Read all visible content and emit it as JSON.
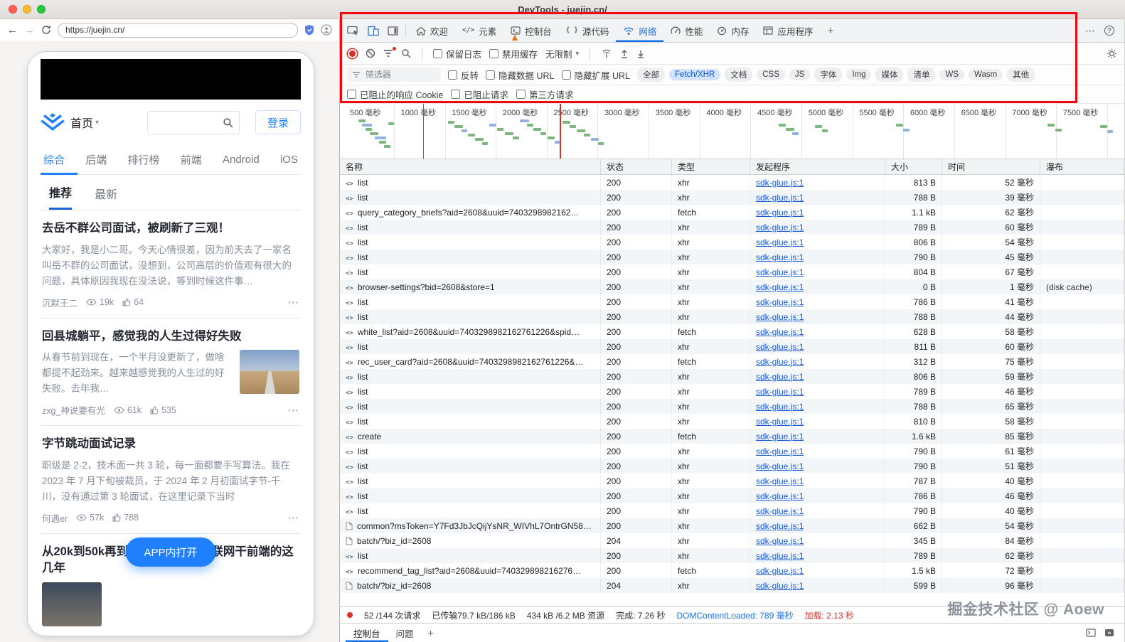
{
  "window": {
    "title": "DevTools - juejin.cn/"
  },
  "browser": {
    "url": "https://juejin.cn/",
    "site": {
      "home_label": "首页",
      "login_label": "登录",
      "nav_tabs": [
        {
          "label": "综合",
          "active": true
        },
        {
          "label": "后端",
          "active": false
        },
        {
          "label": "排行榜",
          "active": false
        },
        {
          "label": "前端",
          "active": false
        },
        {
          "label": "Android",
          "active": false
        },
        {
          "label": "iOS",
          "active": false
        }
      ],
      "sub_tabs": [
        {
          "label": "推荐",
          "active": true
        },
        {
          "label": "最新",
          "active": false
        }
      ],
      "articles": [
        {
          "title": "去岳不群公司面试，被刷新了三观！",
          "excerpt": "大家好，我是小二哥。今天心情很差，因为前天去了一家名叫岳不群的公司面试，没想到，公司高层的价值观有很大的问题，具体原因我现在没法说，等到时候这件事…",
          "author": "沉默王二",
          "views": "19k",
          "likes": "64",
          "has_image": false
        },
        {
          "title": "回县城躺平，感觉我的人生过得好失败",
          "excerpt": "从春节前到现在，一个半月没更新了，做啥都提不起劲来。越来越感觉我的人生过的好失败。去年我…",
          "author": "zxg_神说要有光",
          "views": "61k",
          "likes": "535",
          "has_image": true
        },
        {
          "title": "字节跳动面试记录",
          "excerpt": "职级是 2-2，技术面一共 3 轮，每一面都要手写算法。我在 2023 年 7 月下旬被裁员，于 2024 年 2 月初面试字节-千川，没有通过第 3 轮面试，在这里记录下当时",
          "author": "何遇er",
          "views": "57k",
          "likes": "788",
          "has_image": false
        },
        {
          "title": "从20k到50k再到2k，聊聊我在互联网干前端的这几年",
          "excerpt": "",
          "author": "",
          "views": "",
          "likes": "",
          "has_image": true
        }
      ],
      "open_in_app": "APP内打开"
    }
  },
  "devtools": {
    "main_tabs": [
      {
        "icon": "home-icon",
        "label": "欢迎",
        "active": false
      },
      {
        "icon": "elements-icon",
        "label": "元素",
        "active": false
      },
      {
        "icon": "console-icon",
        "label": "控制台",
        "active": false,
        "badge": true
      },
      {
        "icon": "sources-icon",
        "label": "源代码",
        "active": false
      },
      {
        "icon": "network-icon",
        "label": "网络",
        "active": true
      },
      {
        "icon": "performance-icon",
        "label": "性能",
        "active": false
      },
      {
        "icon": "memory-icon",
        "label": "内存",
        "active": false
      },
      {
        "icon": "application-icon",
        "label": "应用程序",
        "active": false
      }
    ],
    "more_tabs_label": "+",
    "network_toolbar": {
      "preserve_log": "保留日志",
      "disable_cache": "禁用缓存",
      "throttling": "无限制"
    },
    "filter_bar": {
      "placeholder": "筛选器",
      "invert": "反转",
      "hide_data_urls": "隐藏数据 URL",
      "hide_extension_urls": "隐藏扩展 URL",
      "pills": [
        {
          "label": "全部",
          "active": false
        },
        {
          "label": "Fetch/XHR",
          "active": true
        },
        {
          "label": "文档",
          "active": false
        },
        {
          "label": "CSS",
          "active": false
        },
        {
          "label": "JS",
          "active": false
        },
        {
          "label": "字体",
          "active": false
        },
        {
          "label": "Img",
          "active": false
        },
        {
          "label": "媒体",
          "active": false
        },
        {
          "label": "清单",
          "active": false
        },
        {
          "label": "WS",
          "active": false
        },
        {
          "label": "Wasm",
          "active": false
        },
        {
          "label": "其他",
          "active": false
        }
      ]
    },
    "block_bar": {
      "blocked_cookies": "已阻止的响应 Cookie",
      "blocked_requests": "已阻止请求",
      "third_party": "第三方请求"
    },
    "overview": {
      "tick_labels": [
        "500 毫秒",
        "1000 毫秒",
        "1500 毫秒",
        "2000 毫秒",
        "2500 毫秒",
        "3000 毫秒",
        "3500 毫秒",
        "4000 毫秒",
        "4500 毫秒",
        "5000 毫秒",
        "5500 毫秒",
        "6000 毫秒",
        "6500 毫秒",
        "7000 毫秒",
        "7500 毫秒"
      ],
      "dcl_line_pct": 10.6,
      "load_line_pct": 28.05,
      "bars": [
        {
          "p": 2.4,
          "t": 22,
          "w": 10,
          "c": "g"
        },
        {
          "p": 2.8,
          "t": 28,
          "w": 14,
          "c": "b"
        },
        {
          "p": 3.3,
          "t": 34,
          "w": 9,
          "c": "g"
        },
        {
          "p": 3.8,
          "t": 40,
          "w": 12,
          "c": "g"
        },
        {
          "p": 4.4,
          "t": 46,
          "w": 16,
          "c": "b"
        },
        {
          "p": 5.0,
          "t": 52,
          "w": 10,
          "c": "g"
        },
        {
          "p": 5.6,
          "t": 58,
          "w": 9,
          "c": "g"
        },
        {
          "p": 6.2,
          "t": 26,
          "w": 8,
          "c": "g"
        },
        {
          "p": 13.8,
          "t": 24,
          "w": 9,
          "c": "g"
        },
        {
          "p": 14.6,
          "t": 30,
          "w": 12,
          "c": "g"
        },
        {
          "p": 15.5,
          "t": 36,
          "w": 8,
          "c": "b"
        },
        {
          "p": 16.3,
          "t": 42,
          "w": 10,
          "c": "g"
        },
        {
          "p": 17.2,
          "t": 48,
          "w": 12,
          "c": "g"
        },
        {
          "p": 18.1,
          "t": 54,
          "w": 8,
          "c": "g"
        },
        {
          "p": 19.0,
          "t": 28,
          "w": 10,
          "c": "b"
        },
        {
          "p": 20.0,
          "t": 34,
          "w": 9,
          "c": "g"
        },
        {
          "p": 21.0,
          "t": 40,
          "w": 12,
          "c": "g"
        },
        {
          "p": 22.0,
          "t": 46,
          "w": 9,
          "c": "g"
        },
        {
          "p": 22.9,
          "t": 22,
          "w": 13,
          "c": "b"
        },
        {
          "p": 23.8,
          "t": 28,
          "w": 9,
          "c": "g"
        },
        {
          "p": 24.7,
          "t": 34,
          "w": 11,
          "c": "g"
        },
        {
          "p": 25.6,
          "t": 40,
          "w": 8,
          "c": "g"
        },
        {
          "p": 26.5,
          "t": 46,
          "w": 10,
          "c": "g"
        },
        {
          "p": 27.4,
          "t": 52,
          "w": 9,
          "c": "b"
        },
        {
          "p": 28.4,
          "t": 24,
          "w": 11,
          "c": "g"
        },
        {
          "p": 29.3,
          "t": 30,
          "w": 9,
          "c": "g"
        },
        {
          "p": 30.2,
          "t": 36,
          "w": 12,
          "c": "g"
        },
        {
          "p": 31.1,
          "t": 42,
          "w": 9,
          "c": "g"
        },
        {
          "p": 32.0,
          "t": 48,
          "w": 11,
          "c": "b"
        },
        {
          "p": 32.9,
          "t": 54,
          "w": 8,
          "c": "g"
        },
        {
          "p": 55.9,
          "t": 28,
          "w": 10,
          "c": "g"
        },
        {
          "p": 56.8,
          "t": 34,
          "w": 12,
          "c": "g"
        },
        {
          "p": 57.7,
          "t": 40,
          "w": 9,
          "c": "b"
        },
        {
          "p": 60.6,
          "t": 30,
          "w": 10,
          "c": "g"
        },
        {
          "p": 61.5,
          "t": 36,
          "w": 8,
          "c": "g"
        },
        {
          "p": 70.9,
          "t": 28,
          "w": 10,
          "c": "g"
        },
        {
          "p": 71.8,
          "t": 35,
          "w": 9,
          "c": "b"
        },
        {
          "p": 90.2,
          "t": 28,
          "w": 10,
          "c": "g"
        },
        {
          "p": 91.2,
          "t": 35,
          "w": 9,
          "c": "g"
        },
        {
          "p": 96.9,
          "t": 30,
          "w": 10,
          "c": "g"
        },
        {
          "p": 97.8,
          "t": 37,
          "w": 8,
          "c": "b"
        }
      ]
    },
    "table": {
      "columns": [
        "名称",
        "状态",
        "类型",
        "发起程序",
        "大小",
        "时间",
        "瀑布"
      ],
      "rows": [
        {
          "icon": "code",
          "name": "list",
          "status": "200",
          "type": "xhr",
          "initiator": "sdk-glue.js:1",
          "size": "813 B",
          "time": "52 毫秒",
          "note": ""
        },
        {
          "icon": "code",
          "name": "list",
          "status": "200",
          "type": "xhr",
          "initiator": "sdk-glue.js:1",
          "size": "788 B",
          "time": "39 毫秒",
          "note": ""
        },
        {
          "icon": "code",
          "name": "query_category_briefs?aid=2608&uuid=7403298982162…",
          "status": "200",
          "type": "fetch",
          "initiator": "sdk-glue.js:1",
          "size": "1.1 kB",
          "time": "62 毫秒",
          "note": ""
        },
        {
          "icon": "code",
          "name": "list",
          "status": "200",
          "type": "xhr",
          "initiator": "sdk-glue.js:1",
          "size": "789 B",
          "time": "60 毫秒",
          "note": ""
        },
        {
          "icon": "code",
          "name": "list",
          "status": "200",
          "type": "xhr",
          "initiator": "sdk-glue.js:1",
          "size": "806 B",
          "time": "54 毫秒",
          "note": ""
        },
        {
          "icon": "code",
          "name": "list",
          "status": "200",
          "type": "xhr",
          "initiator": "sdk-glue.js:1",
          "size": "790 B",
          "time": "45 毫秒",
          "note": ""
        },
        {
          "icon": "code",
          "name": "list",
          "status": "200",
          "type": "xhr",
          "initiator": "sdk-glue.js:1",
          "size": "804 B",
          "time": "67 毫秒",
          "note": ""
        },
        {
          "icon": "code",
          "name": "browser-settings?bid=2608&store=1",
          "status": "200",
          "type": "xhr",
          "initiator": "sdk-glue.js:1",
          "size": "0 B",
          "time": "1 毫秒",
          "note": "(disk cache)"
        },
        {
          "icon": "code",
          "name": "list",
          "status": "200",
          "type": "xhr",
          "initiator": "sdk-glue.js:1",
          "size": "786 B",
          "time": "41 毫秒",
          "note": ""
        },
        {
          "icon": "code",
          "name": "list",
          "status": "200",
          "type": "xhr",
          "initiator": "sdk-glue.js:1",
          "size": "788 B",
          "time": "44 毫秒",
          "note": ""
        },
        {
          "icon": "code",
          "name": "white_list?aid=2608&uuid=7403298982162761226&spid…",
          "status": "200",
          "type": "fetch",
          "initiator": "sdk-glue.js:1",
          "size": "628 B",
          "time": "58 毫秒",
          "note": ""
        },
        {
          "icon": "code",
          "name": "list",
          "status": "200",
          "type": "xhr",
          "initiator": "sdk-glue.js:1",
          "size": "811 B",
          "time": "60 毫秒",
          "note": ""
        },
        {
          "icon": "code",
          "name": "rec_user_card?aid=2608&uuid=7403298982162761226&…",
          "status": "200",
          "type": "fetch",
          "initiator": "sdk-glue.js:1",
          "size": "312 B",
          "time": "75 毫秒",
          "note": ""
        },
        {
          "icon": "code",
          "name": "list",
          "status": "200",
          "type": "xhr",
          "initiator": "sdk-glue.js:1",
          "size": "806 B",
          "time": "59 毫秒",
          "note": ""
        },
        {
          "icon": "code",
          "name": "list",
          "status": "200",
          "type": "xhr",
          "initiator": "sdk-glue.js:1",
          "size": "789 B",
          "time": "46 毫秒",
          "note": ""
        },
        {
          "icon": "code",
          "name": "list",
          "status": "200",
          "type": "xhr",
          "initiator": "sdk-glue.js:1",
          "size": "788 B",
          "time": "65 毫秒",
          "note": ""
        },
        {
          "icon": "code",
          "name": "list",
          "status": "200",
          "type": "xhr",
          "initiator": "sdk-glue.js:1",
          "size": "810 B",
          "time": "58 毫秒",
          "note": ""
        },
        {
          "icon": "code",
          "name": "create",
          "status": "200",
          "type": "fetch",
          "initiator": "sdk-glue.js:1",
          "size": "1.6 kB",
          "time": "85 毫秒",
          "note": ""
        },
        {
          "icon": "code",
          "name": "list",
          "status": "200",
          "type": "xhr",
          "initiator": "sdk-glue.js:1",
          "size": "790 B",
          "time": "61 毫秒",
          "note": ""
        },
        {
          "icon": "code",
          "name": "list",
          "status": "200",
          "type": "xhr",
          "initiator": "sdk-glue.js:1",
          "size": "790 B",
          "time": "51 毫秒",
          "note": ""
        },
        {
          "icon": "code",
          "name": "list",
          "status": "200",
          "type": "xhr",
          "initiator": "sdk-glue.js:1",
          "size": "787 B",
          "time": "40 毫秒",
          "note": ""
        },
        {
          "icon": "code",
          "name": "list",
          "status": "200",
          "type": "xhr",
          "initiator": "sdk-glue.js:1",
          "size": "786 B",
          "time": "46 毫秒",
          "note": ""
        },
        {
          "icon": "code",
          "name": "list",
          "status": "200",
          "type": "xhr",
          "initiator": "sdk-glue.js:1",
          "size": "790 B",
          "time": "40 毫秒",
          "note": ""
        },
        {
          "icon": "doc",
          "name": "common?msToken=Y7Fd3JbJcQijYsNR_WIVhL7OntrGN58…",
          "status": "200",
          "type": "xhr",
          "initiator": "sdk-glue.js:1",
          "size": "662 B",
          "time": "54 毫秒",
          "note": ""
        },
        {
          "icon": "doc",
          "name": "batch/?biz_id=2608",
          "status": "204",
          "type": "xhr",
          "initiator": "sdk-glue.js:1",
          "size": "345 B",
          "time": "84 毫秒",
          "note": ""
        },
        {
          "icon": "code",
          "name": "list",
          "status": "200",
          "type": "xhr",
          "initiator": "sdk-glue.js:1",
          "size": "789 B",
          "time": "62 毫秒",
          "note": ""
        },
        {
          "icon": "code",
          "name": "recommend_tag_list?aid=2608&uuid=740329898216276…",
          "status": "200",
          "type": "fetch",
          "initiator": "sdk-glue.js:1",
          "size": "1.5 kB",
          "time": "72 毫秒",
          "note": ""
        },
        {
          "icon": "doc",
          "name": "batch/?biz_id=2608",
          "status": "204",
          "type": "xhr",
          "initiator": "sdk-glue.js:1",
          "size": "599 B",
          "time": "96 毫秒",
          "note": ""
        }
      ]
    },
    "status_bar": {
      "requests": "52 /144 次请求",
      "transferred": "已传输79.7 kB/186 kB",
      "resources": "434 kB /6.2 MB 资源",
      "finish": "完成: 7.26 秒",
      "dcl": "DOMContentLoaded: 789 毫秒",
      "load": "加载: 2.13 秒"
    },
    "drawer": {
      "tabs": [
        {
          "label": "控制台",
          "active": true
        },
        {
          "label": "问题",
          "active": false
        }
      ],
      "add_label": "+"
    },
    "watermark": "掘金技术社区 @ Aoew"
  }
}
